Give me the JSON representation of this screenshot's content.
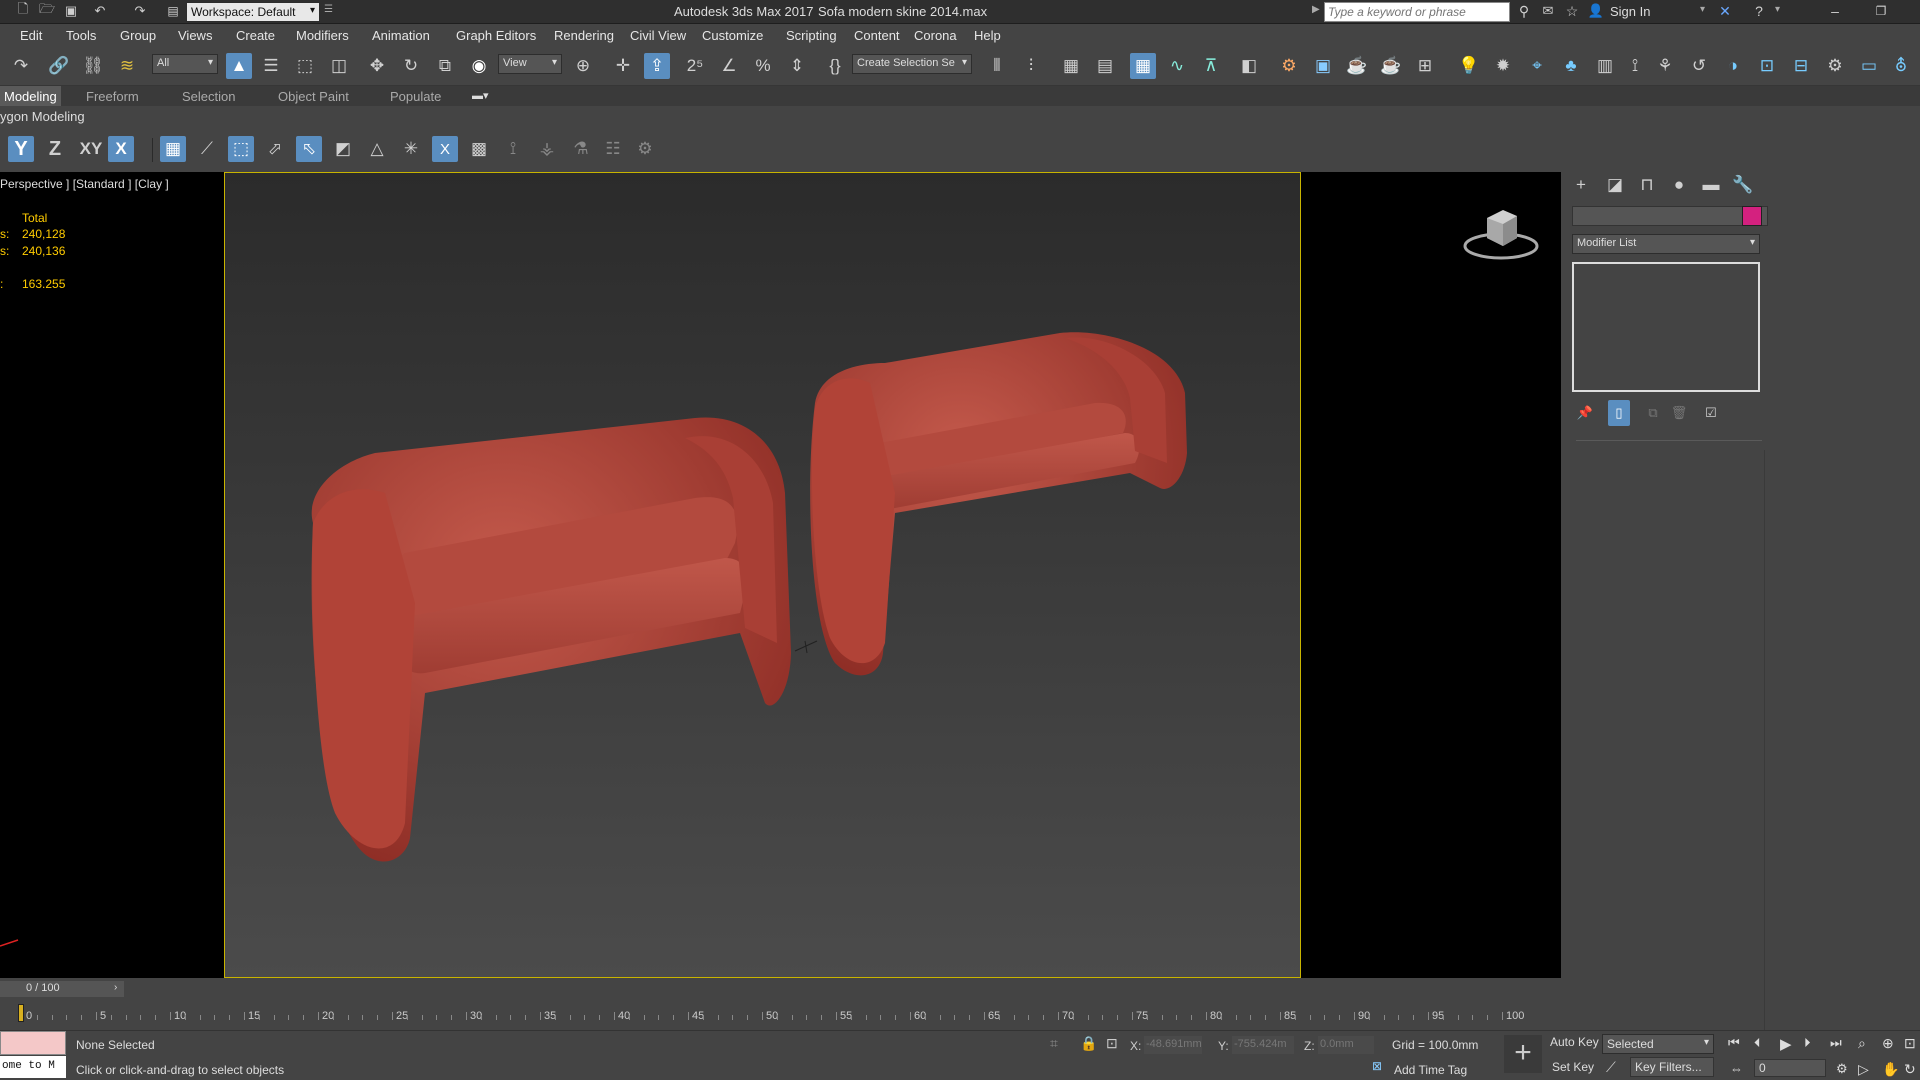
{
  "titlebar": {
    "workspace": "Workspace: Default",
    "title": "Autodesk 3ds Max 2017",
    "filename": "Sofa modern skine 2014.max",
    "search_placeholder": "Type a keyword or phrase",
    "sign_in": "Sign In"
  },
  "menu": [
    "Edit",
    "Tools",
    "Group",
    "Views",
    "Create",
    "Modifiers",
    "Animation",
    "Graph Editors",
    "Rendering",
    "Civil View",
    "Customize",
    "Scripting",
    "Content",
    "Corona",
    "Help"
  ],
  "toolbar": {
    "filter": "All",
    "ref_coord": "View",
    "selection_set": "Create Selection Se"
  },
  "ribbon": {
    "tabs": [
      "Modeling",
      "Freeform",
      "Selection",
      "Object Paint",
      "Populate"
    ],
    "panel": "ygon Modeling"
  },
  "axis_buttons": [
    "Y",
    "Z",
    "XY",
    "X"
  ],
  "viewport": {
    "label": "Perspective ] [Standard ] [Clay ]",
    "stats_header": "Total",
    "stats": [
      {
        "label": "s:",
        "value": "240,128"
      },
      {
        "label": "s:",
        "value": "240,136"
      },
      {
        "label": ":",
        "value": "163.255"
      }
    ]
  },
  "command_panel": {
    "modifier_list": "Modifier List",
    "color": "#d4217f"
  },
  "timeline": {
    "frame": "0 / 100",
    "ticks": [
      "0",
      "5",
      "10",
      "15",
      "20",
      "25",
      "30",
      "35",
      "40",
      "45",
      "50",
      "55",
      "60",
      "65",
      "70",
      "75",
      "80",
      "85",
      "90",
      "95",
      "100"
    ]
  },
  "status": {
    "maxscript": "ome to M",
    "selection": "None Selected",
    "prompt": "Click or click-and-drag to select objects",
    "x_label": "X:",
    "x_value": "-48.691mm",
    "y_label": "Y:",
    "y_value": "-755.424m",
    "z_label": "Z:",
    "z_value": "0.0mm",
    "grid": "Grid = 100.0mm",
    "add_time_tag": "Add Time Tag",
    "auto_key": "Auto Key",
    "set_key": "Set Key",
    "key_mode": "Selected",
    "key_filters": "Key Filters...",
    "frame_value": "0"
  }
}
